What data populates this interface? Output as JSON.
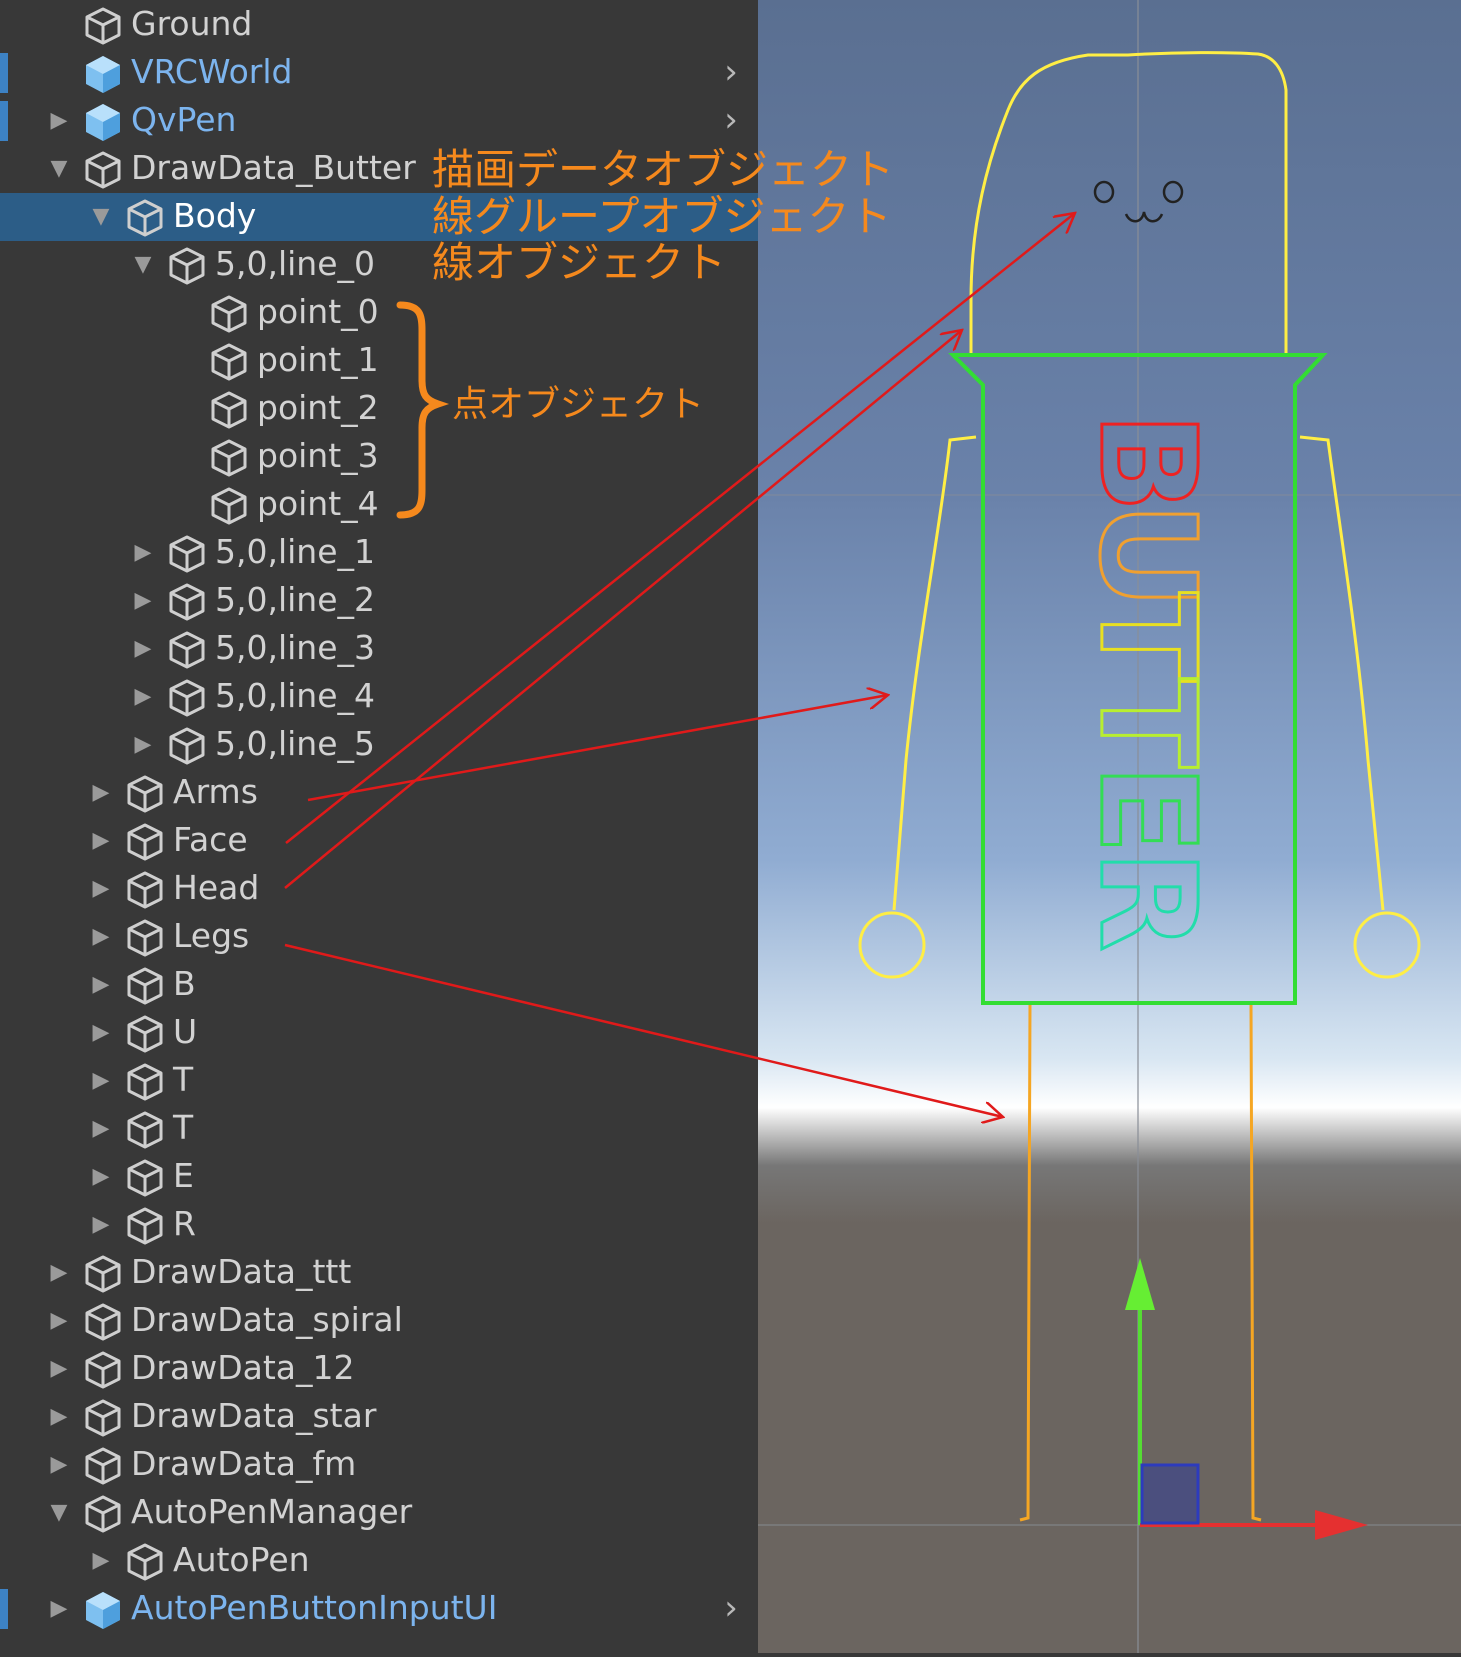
{
  "hierarchy": {
    "items": [
      {
        "label": "Ground",
        "depth": 1,
        "arrow": "none",
        "prefab": false
      },
      {
        "label": "VRCWorld",
        "depth": 1,
        "arrow": "none",
        "prefab": true
      },
      {
        "label": "QvPen",
        "depth": 1,
        "arrow": "collapsed",
        "prefab": true
      },
      {
        "label": "DrawData_Butter",
        "depth": 1,
        "arrow": "expanded",
        "prefab": false
      },
      {
        "label": "Body",
        "depth": 2,
        "arrow": "expanded",
        "prefab": false,
        "selected": true
      },
      {
        "label": "5,0,line_0",
        "depth": 3,
        "arrow": "expanded",
        "prefab": false
      },
      {
        "label": "point_0",
        "depth": 4,
        "arrow": "none",
        "prefab": false
      },
      {
        "label": "point_1",
        "depth": 4,
        "arrow": "none",
        "prefab": false
      },
      {
        "label": "point_2",
        "depth": 4,
        "arrow": "none",
        "prefab": false
      },
      {
        "label": "point_3",
        "depth": 4,
        "arrow": "none",
        "prefab": false
      },
      {
        "label": "point_4",
        "depth": 4,
        "arrow": "none",
        "prefab": false
      },
      {
        "label": "5,0,line_1",
        "depth": 3,
        "arrow": "collapsed",
        "prefab": false
      },
      {
        "label": "5,0,line_2",
        "depth": 3,
        "arrow": "collapsed",
        "prefab": false
      },
      {
        "label": "5,0,line_3",
        "depth": 3,
        "arrow": "collapsed",
        "prefab": false
      },
      {
        "label": "5,0,line_4",
        "depth": 3,
        "arrow": "collapsed",
        "prefab": false
      },
      {
        "label": "5,0,line_5",
        "depth": 3,
        "arrow": "collapsed",
        "prefab": false
      },
      {
        "label": "Arms",
        "depth": 2,
        "arrow": "collapsed",
        "prefab": false
      },
      {
        "label": "Face",
        "depth": 2,
        "arrow": "collapsed",
        "prefab": false
      },
      {
        "label": "Head",
        "depth": 2,
        "arrow": "collapsed",
        "prefab": false
      },
      {
        "label": "Legs",
        "depth": 2,
        "arrow": "collapsed",
        "prefab": false
      },
      {
        "label": "B",
        "depth": 2,
        "arrow": "collapsed",
        "prefab": false
      },
      {
        "label": "U",
        "depth": 2,
        "arrow": "collapsed",
        "prefab": false
      },
      {
        "label": "T",
        "depth": 2,
        "arrow": "collapsed",
        "prefab": false
      },
      {
        "label": "T",
        "depth": 2,
        "arrow": "collapsed",
        "prefab": false
      },
      {
        "label": "E",
        "depth": 2,
        "arrow": "collapsed",
        "prefab": false
      },
      {
        "label": "R",
        "depth": 2,
        "arrow": "collapsed",
        "prefab": false
      },
      {
        "label": "DrawData_ttt",
        "depth": 1,
        "arrow": "collapsed",
        "prefab": false
      },
      {
        "label": "DrawData_spiral",
        "depth": 1,
        "arrow": "collapsed",
        "prefab": false
      },
      {
        "label": "DrawData_12",
        "depth": 1,
        "arrow": "collapsed",
        "prefab": false
      },
      {
        "label": "DrawData_star",
        "depth": 1,
        "arrow": "collapsed",
        "prefab": false
      },
      {
        "label": "DrawData_fm",
        "depth": 1,
        "arrow": "collapsed",
        "prefab": false
      },
      {
        "label": "AutoPenManager",
        "depth": 1,
        "arrow": "expanded",
        "prefab": false
      },
      {
        "label": "AutoPen",
        "depth": 2,
        "arrow": "collapsed",
        "prefab": false
      },
      {
        "label": "AutoPenButtonInputUI",
        "depth": 1,
        "arrow": "collapsed",
        "prefab": true
      }
    ]
  },
  "annotations": {
    "draw_data_object": "描画データオブジェクト",
    "line_group_object": "線グループオブジェクト",
    "line_object": "線オブジェクト",
    "point_object": "点オブジェクト"
  },
  "scene": {
    "letters": [
      "B",
      "U",
      "T",
      "T",
      "E",
      "R"
    ]
  },
  "colors": {
    "panel_bg": "#383838",
    "selection": "#2c5d87",
    "prefab_text": "#7cb4ee",
    "annotation": "#f5891d",
    "arrow": "#e01a1a",
    "head_outline": "#ffee44",
    "body_outline": "#33dd33",
    "legs": "#f5a623"
  }
}
